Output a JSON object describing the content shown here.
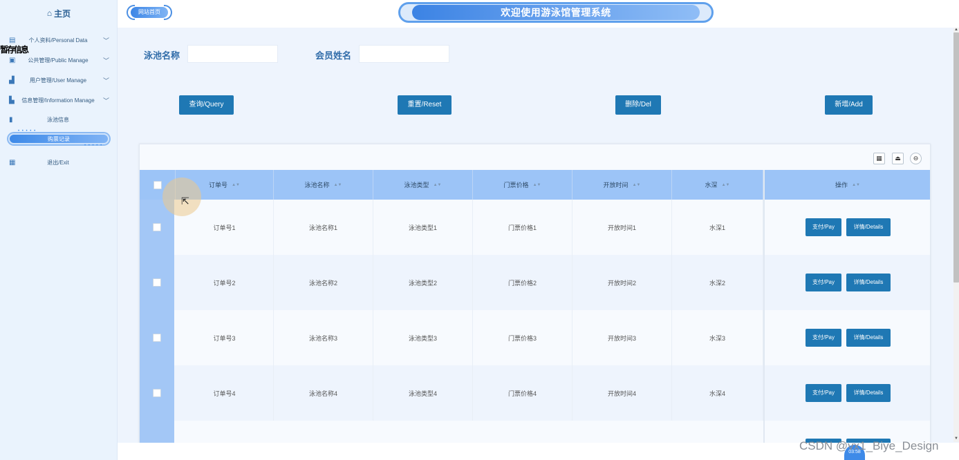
{
  "sidebar": {
    "home_label": "主页",
    "overlap_text": "暂存信息",
    "items": [
      {
        "label": "个人资料/Personal Data",
        "icon": "document-icon",
        "expandable": true
      },
      {
        "label": "公共管理/Public Manage",
        "icon": "clipboard-icon",
        "expandable": true
      },
      {
        "label": "用户管理/User Manage",
        "icon": "users-icon",
        "expandable": true
      },
      {
        "label": "信息管理/Information Manage",
        "icon": "chart-icon",
        "expandable": true
      },
      {
        "label": "泳池信息",
        "icon": "bookmark-icon",
        "expandable": false
      },
      {
        "label": "购票记录",
        "active": true
      },
      {
        "label": "退出/Exit",
        "icon": "calendar-icon",
        "expandable": false
      }
    ]
  },
  "header": {
    "home_button": "网站首页",
    "title": "欢迎使用游泳馆管理系统"
  },
  "search": {
    "pool_name_label": "泳池名称",
    "pool_name_value": "",
    "member_name_label": "会员姓名",
    "member_name_value": ""
  },
  "actions": {
    "query": "查询/Query",
    "reset": "重置/Reset",
    "delete": "删除/Del",
    "add": "新增/Add"
  },
  "table": {
    "headers": [
      "订单号",
      "泳池名称",
      "泳池类型",
      "门票价格",
      "开放时间",
      "水深",
      "操作"
    ],
    "rows": [
      [
        "订单号1",
        "泳池名称1",
        "泳池类型1",
        "门票价格1",
        "开放时间1",
        "水深1"
      ],
      [
        "订单号2",
        "泳池名称2",
        "泳池类型2",
        "门票价格2",
        "开放时间2",
        "水深2"
      ],
      [
        "订单号3",
        "泳池名称3",
        "泳池类型3",
        "门票价格3",
        "开放时间3",
        "水深3"
      ],
      [
        "订单号4",
        "泳池名称4",
        "泳池类型4",
        "门票价格4",
        "开放时间4",
        "水深4"
      ]
    ],
    "row_actions": {
      "pay": "支付/Pay",
      "details": "详情/Details"
    }
  },
  "overlay": {
    "badge": "03:58",
    "watermark": "CSDN @vx1_Biye_Design"
  },
  "colors": {
    "accent": "#1f78b4",
    "header_row": "#9cc4f7",
    "banner": "#3c83e4"
  }
}
